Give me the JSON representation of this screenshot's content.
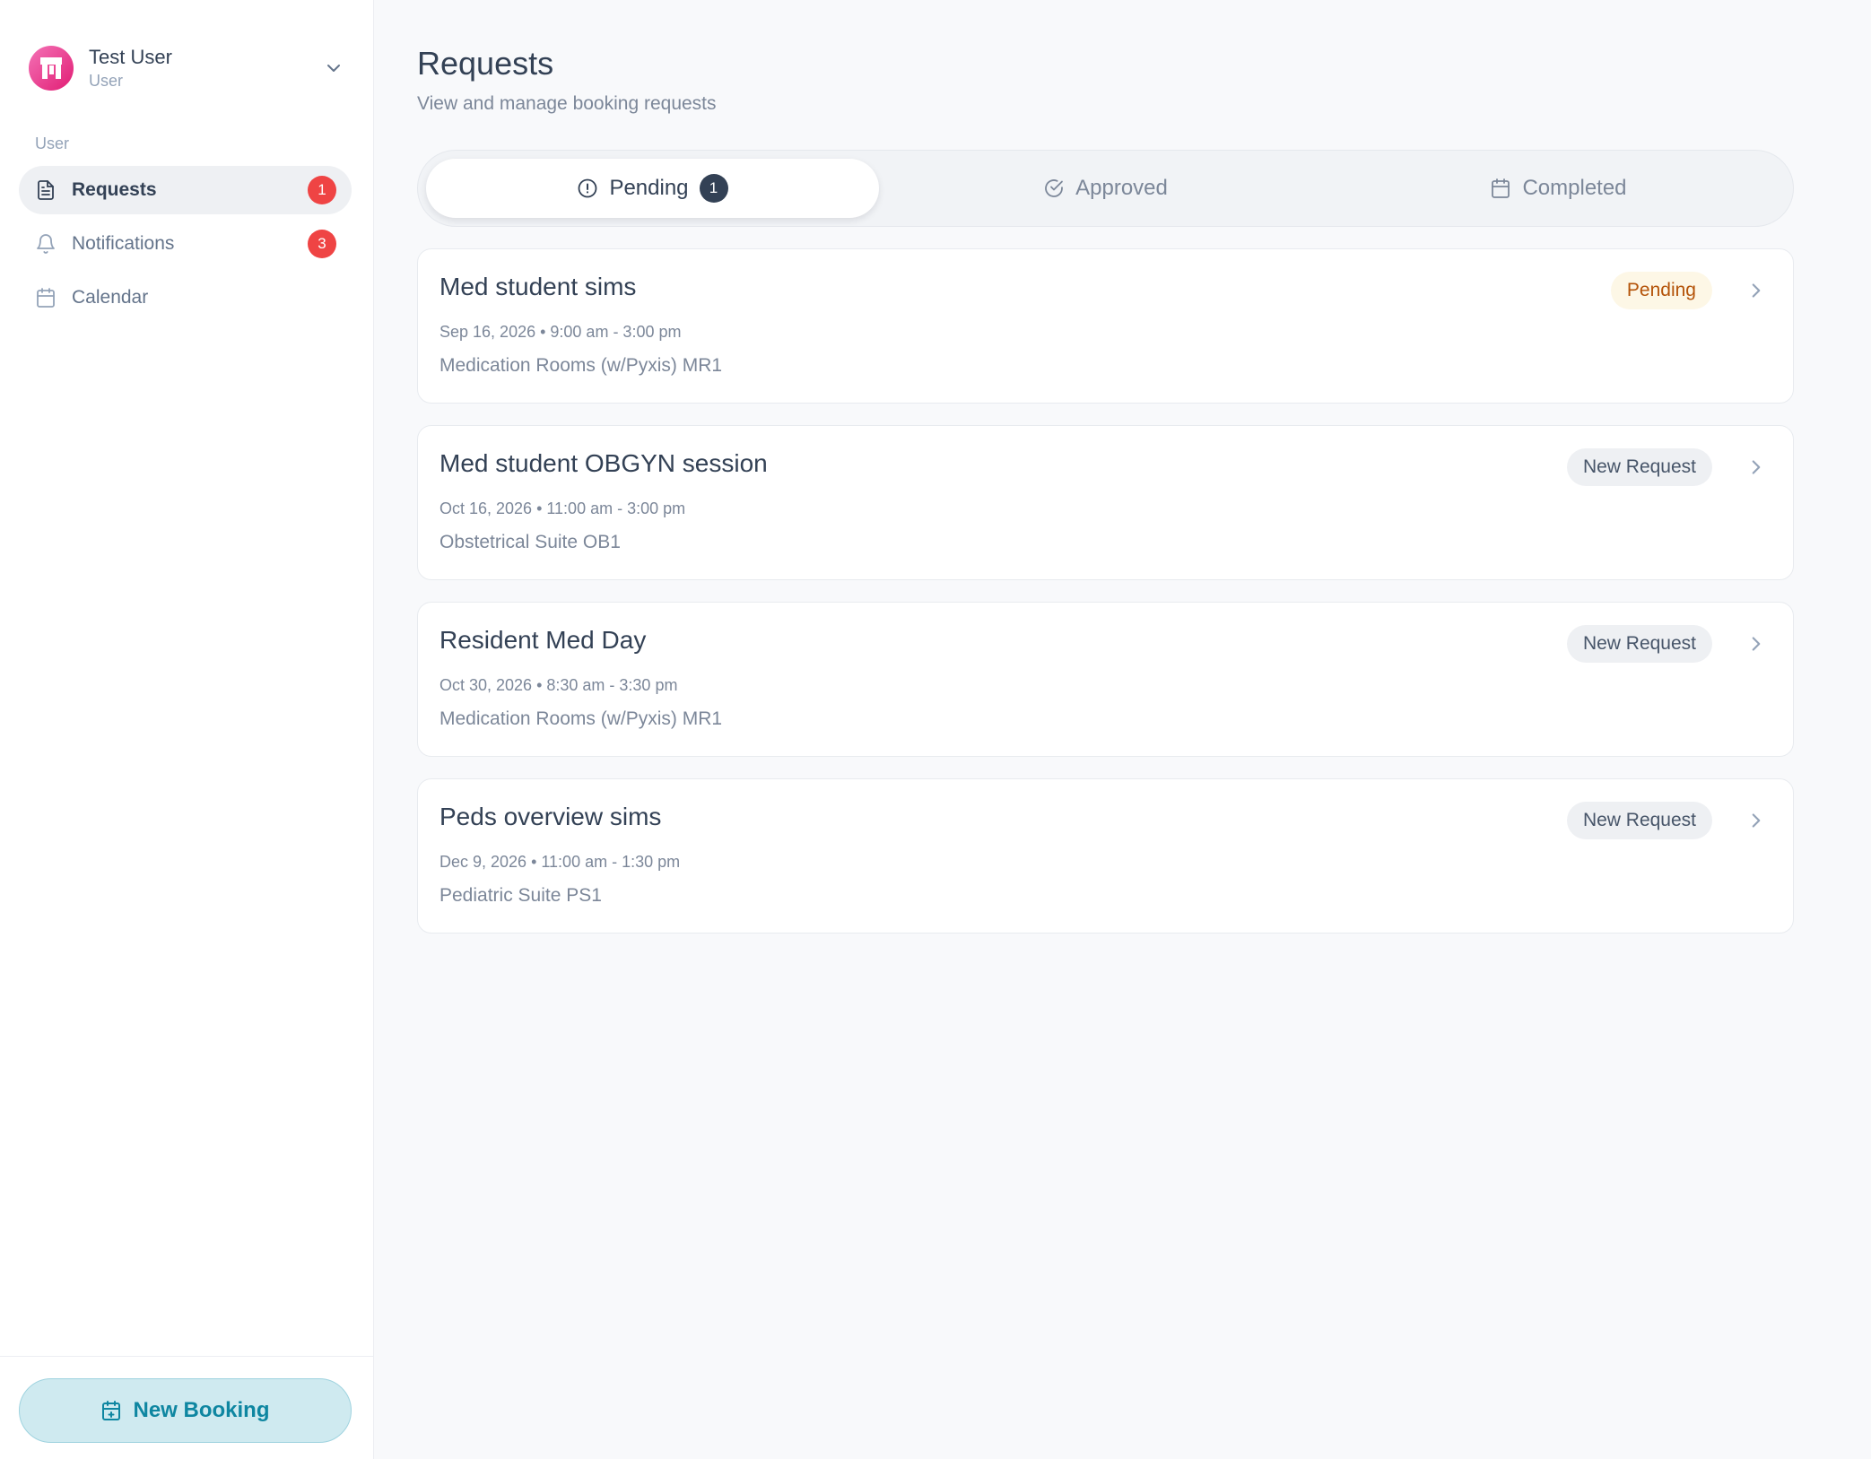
{
  "user": {
    "name": "Test User",
    "role": "User"
  },
  "sidebar": {
    "section_label": "User",
    "items": [
      {
        "label": "Requests",
        "badge": "1",
        "icon": "file-text-icon",
        "active": true
      },
      {
        "label": "Notifications",
        "badge": "3",
        "icon": "bell-icon",
        "active": false
      },
      {
        "label": "Calendar",
        "badge": "",
        "icon": "calendar-icon",
        "active": false
      }
    ],
    "new_booking_label": "New Booking"
  },
  "page": {
    "title": "Requests",
    "subtitle": "View and manage booking requests"
  },
  "tabs": [
    {
      "label": "Pending",
      "badge": "1",
      "icon": "alert-circle-icon",
      "active": true
    },
    {
      "label": "Approved",
      "icon": "check-circle-icon",
      "active": false
    },
    {
      "label": "Completed",
      "icon": "calendar-icon",
      "active": false
    }
  ],
  "requests": [
    {
      "title": "Med student sims",
      "meta": "Sep 16, 2026 • 9:00 am - 3:00 pm",
      "location": "Medication Rooms (w/Pyxis) MR1",
      "status": "Pending"
    },
    {
      "title": "Med student OBGYN session",
      "meta": "Oct 16, 2026 • 11:00 am - 3:00 pm",
      "location": "Obstetrical Suite OB1",
      "status": "New Request"
    },
    {
      "title": "Resident Med Day",
      "meta": "Oct 30, 2026 • 8:30 am - 3:30 pm",
      "location": "Medication Rooms (w/Pyxis) MR1",
      "status": "New Request"
    },
    {
      "title": "Peds overview sims",
      "meta": "Dec 9, 2026 • 11:00 am - 1:30 pm",
      "location": "Pediatric Suite PS1",
      "status": "New Request"
    }
  ],
  "colors": {
    "accent": "#0e86a1",
    "badge_red": "#ef4444",
    "pending_text": "#b45309",
    "pending_bg": "#fdf7e6"
  }
}
